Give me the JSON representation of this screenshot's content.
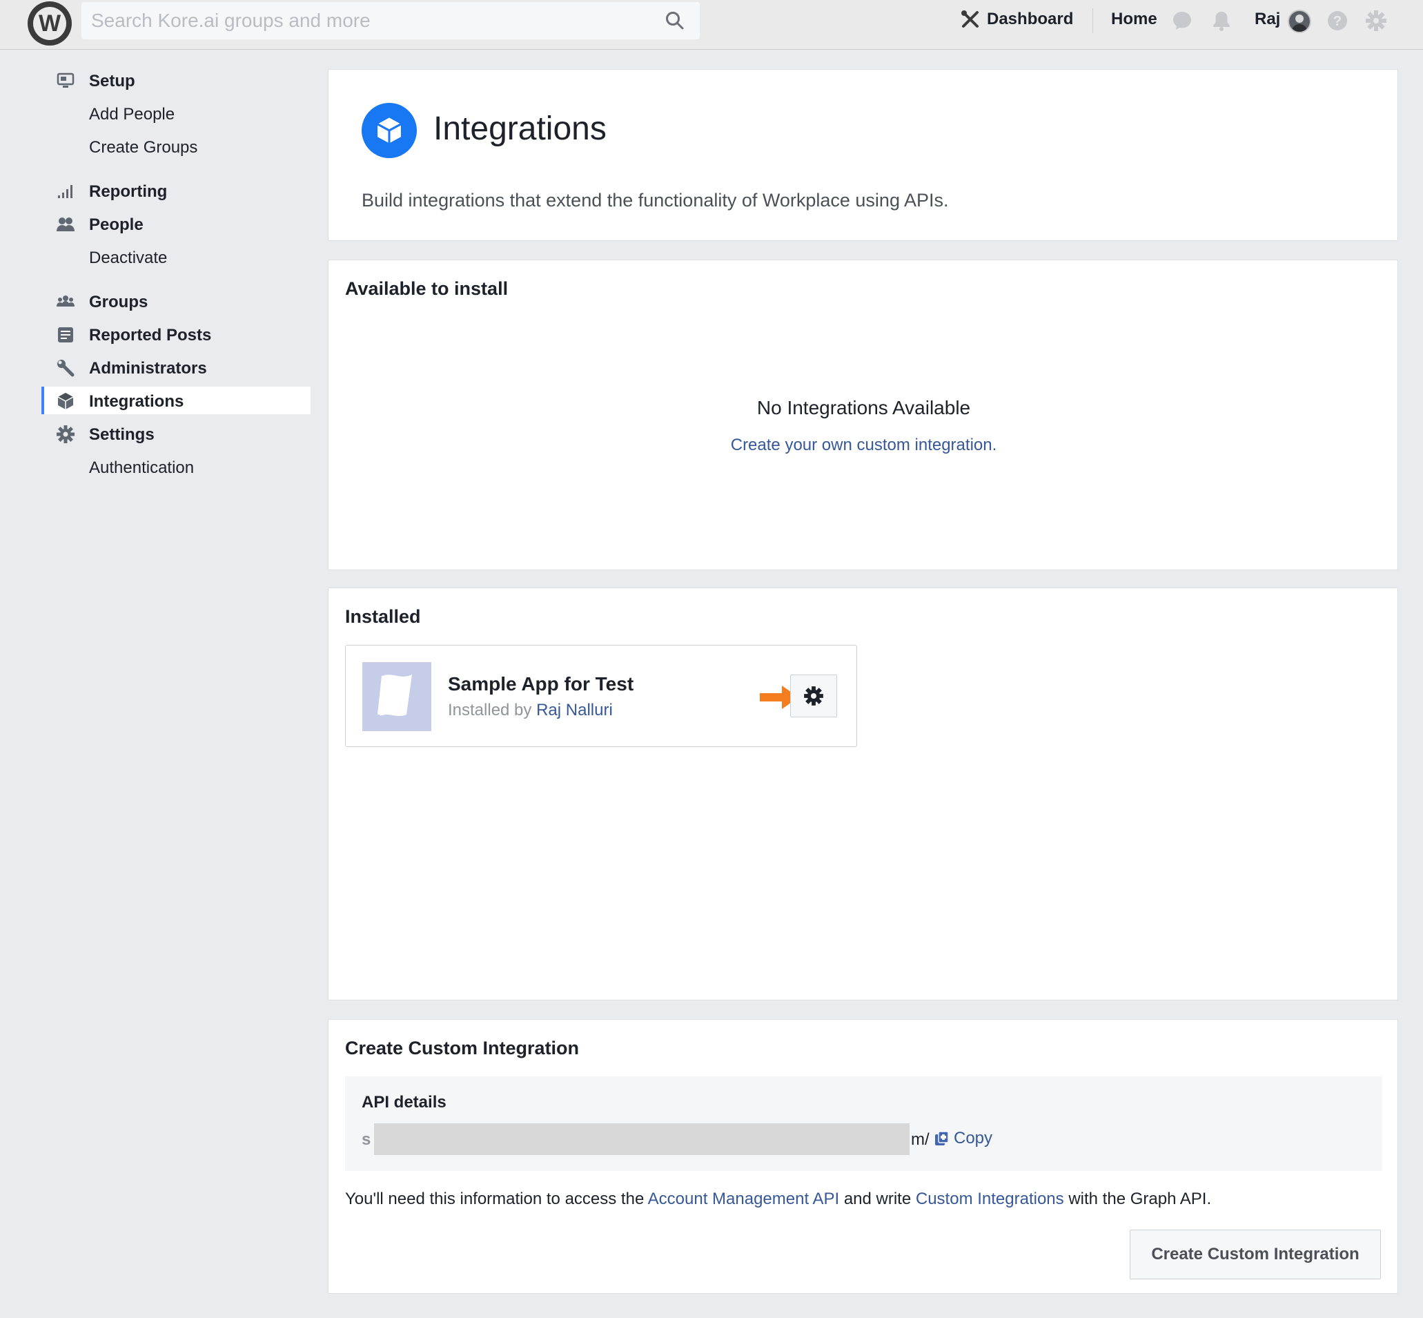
{
  "topbar": {
    "logo_letter": "W",
    "search_placeholder": "Search Kore.ai groups and more",
    "dashboard_label": "Dashboard",
    "home_label": "Home",
    "user_name": "Raj"
  },
  "sidebar": {
    "items": [
      {
        "label": "Setup",
        "icon": "monitor-icon"
      },
      {
        "label": "Add People"
      },
      {
        "label": "Create Groups"
      },
      {
        "label": "Reporting",
        "icon": "bar-chart-icon"
      },
      {
        "label": "People",
        "icon": "people-icon"
      },
      {
        "label": "Deactivate"
      },
      {
        "label": "Groups",
        "icon": "groups-icon"
      },
      {
        "label": "Reported Posts",
        "icon": "document-icon"
      },
      {
        "label": "Administrators",
        "icon": "wrench-icon"
      },
      {
        "label": "Integrations",
        "icon": "cube-icon",
        "active": true
      },
      {
        "label": "Settings",
        "icon": "gear-icon"
      },
      {
        "label": "Authentication"
      }
    ]
  },
  "header": {
    "title": "Integrations",
    "subtitle": "Build integrations that extend the functionality of Workplace using APIs."
  },
  "available": {
    "title": "Available to install",
    "empty_title": "No Integrations Available",
    "empty_link": "Create your own custom integration."
  },
  "installed": {
    "title": "Installed",
    "app_name": "Sample App for Test",
    "installed_by_prefix": "Installed by",
    "installed_by_user": "Raj Nalluri"
  },
  "create": {
    "title": "Create Custom Integration",
    "api_title": "API details",
    "api_value_start": "s",
    "api_value_end": "m/",
    "copy_label": "Copy",
    "note_prefix": "You'll need this information to access the",
    "note_link1": "Account Management API",
    "note_middle": "and write",
    "note_link2": "Custom Integrations",
    "note_suffix": "with the Graph API.",
    "button_label": "Create Custom Integration"
  },
  "colors": {
    "accent": "#1877f2",
    "link": "#365899",
    "arrow": "#f57c1f",
    "active_bar": "#4080ff"
  }
}
